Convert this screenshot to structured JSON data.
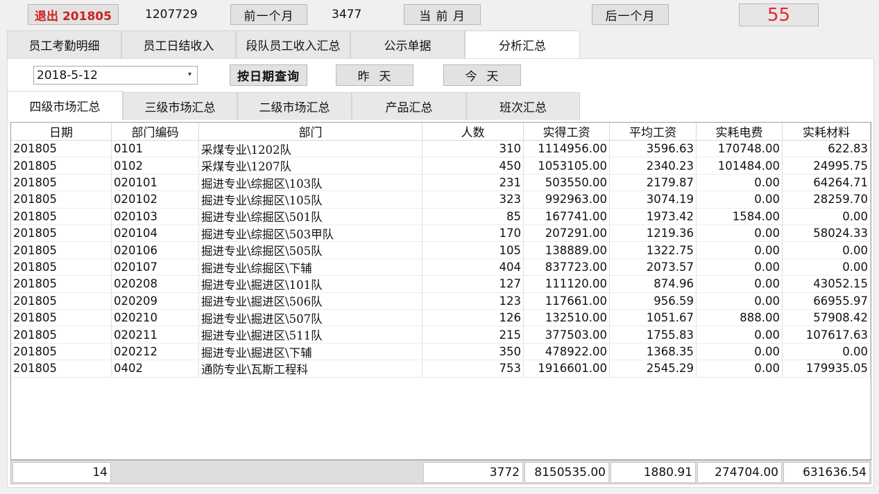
{
  "toolbar": {
    "exit_label": "退出 201805",
    "code": "1207729",
    "prev_month_label": "前一个月",
    "count": "3477",
    "current_month_label": "当 前 月",
    "next_month_label": "后一个月",
    "counter_value": "55"
  },
  "main_tabs": [
    "员工考勤明细",
    "员工日结收入",
    "段队员工收入汇总",
    "公示单据",
    "分析汇总"
  ],
  "active_main_tab": "分析汇总",
  "query": {
    "date_value": "2018-5-12",
    "query_button": "按日期查询",
    "yesterday_button": "昨  天",
    "today_button": "今  天"
  },
  "sub_tabs": [
    "四级市场汇总",
    "三级市场汇总",
    "二级市场汇总",
    "产品汇总",
    "班次汇总"
  ],
  "active_sub_tab": "四级市场汇总",
  "table": {
    "columns": [
      "日期",
      "部门编码",
      "部门",
      "人数",
      "实得工资",
      "平均工资",
      "实耗电费",
      "实耗材料"
    ],
    "rows": [
      [
        "201805",
        "0101",
        "采煤专业\\1202队",
        "310",
        "1114956.00",
        "3596.63",
        "170748.00",
        "622.83"
      ],
      [
        "201805",
        "0102",
        "采煤专业\\1207队",
        "450",
        "1053105.00",
        "2340.23",
        "101484.00",
        "24995.75"
      ],
      [
        "201805",
        "020101",
        "掘进专业\\综掘区\\103队",
        "231",
        "503550.00",
        "2179.87",
        "0.00",
        "64264.71"
      ],
      [
        "201805",
        "020102",
        "掘进专业\\综掘区\\105队",
        "323",
        "992963.00",
        "3074.19",
        "0.00",
        "28259.70"
      ],
      [
        "201805",
        "020103",
        "掘进专业\\综掘区\\501队",
        "85",
        "167741.00",
        "1973.42",
        "1584.00",
        "0.00"
      ],
      [
        "201805",
        "020104",
        "掘进专业\\综掘区\\503甲队",
        "170",
        "207291.00",
        "1219.36",
        "0.00",
        "58024.33"
      ],
      [
        "201805",
        "020106",
        "掘进专业\\综掘区\\505队",
        "105",
        "138889.00",
        "1322.75",
        "0.00",
        "0.00"
      ],
      [
        "201805",
        "020107",
        "掘进专业\\综掘区\\下辅",
        "404",
        "837723.00",
        "2073.57",
        "0.00",
        "0.00"
      ],
      [
        "201805",
        "020208",
        "掘进专业\\掘进区\\101队",
        "127",
        "111120.00",
        "874.96",
        "0.00",
        "43052.15"
      ],
      [
        "201805",
        "020209",
        "掘进专业\\掘进区\\506队",
        "123",
        "117661.00",
        "956.59",
        "0.00",
        "66955.97"
      ],
      [
        "201805",
        "020210",
        "掘进专业\\掘进区\\507队",
        "126",
        "132510.00",
        "1051.67",
        "888.00",
        "57908.42"
      ],
      [
        "201805",
        "020211",
        "掘进专业\\掘进区\\511队",
        "215",
        "377503.00",
        "1755.83",
        "0.00",
        "107617.63"
      ],
      [
        "201805",
        "020212",
        "掘进专业\\掘进区\\下辅",
        "350",
        "478922.00",
        "1368.35",
        "0.00",
        "0.00"
      ],
      [
        "201805",
        "0402",
        "通防专业\\瓦斯工程科",
        "753",
        "1916601.00",
        "2545.29",
        "0.00",
        "179935.05"
      ]
    ]
  },
  "totals": {
    "row_count": "14",
    "people": "3772",
    "wages": "8150535.00",
    "avg_wage": "1880.91",
    "electric": "274704.00",
    "material": "631636.54"
  },
  "colors": {
    "exit_text": "#d21e1e",
    "counter_text": "#e3262e"
  }
}
